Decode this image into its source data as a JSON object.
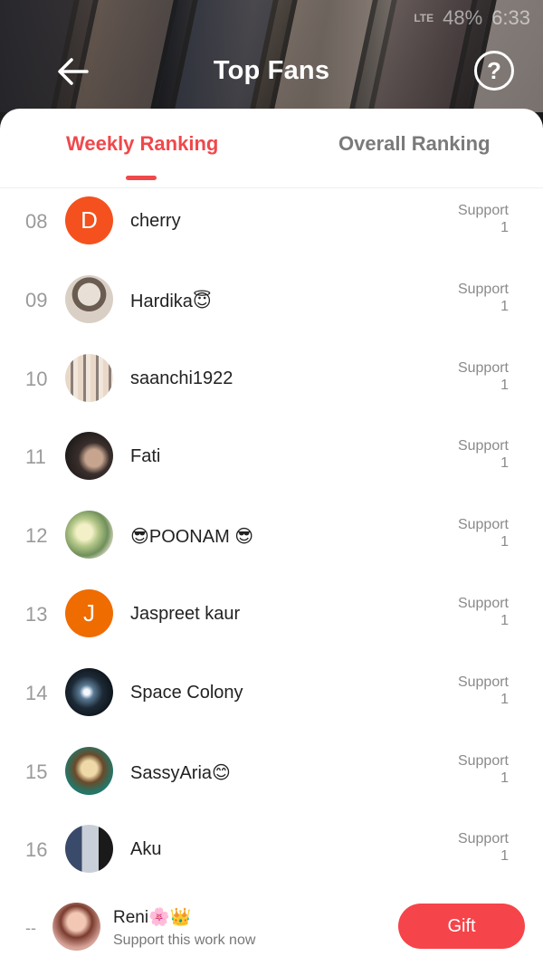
{
  "header": {
    "title": "Top Fans",
    "status_network": "LTE",
    "status_time": "6:33",
    "status_battery": "48%"
  },
  "tabs": [
    {
      "label": "Weekly Ranking",
      "active": true
    },
    {
      "label": "Overall Ranking",
      "active": false
    }
  ],
  "support_label": "Support",
  "fans": [
    {
      "rank": "08",
      "name": "cherry",
      "avatar_letter": "D",
      "avatar_type": "letter",
      "support": "1"
    },
    {
      "rank": "09",
      "name": "Hardika😇",
      "avatar_type": "photo",
      "support": "1"
    },
    {
      "rank": "10",
      "name": "saanchi1922",
      "avatar_type": "photo",
      "support": "1"
    },
    {
      "rank": "11",
      "name": "Fati",
      "avatar_type": "photo",
      "support": "1"
    },
    {
      "rank": "12",
      "name": "😎POONAM 😎",
      "avatar_type": "photo",
      "support": "1"
    },
    {
      "rank": "13",
      "name": "Jaspreet kaur",
      "avatar_letter": "J",
      "avatar_type": "letter",
      "support": "1"
    },
    {
      "rank": "14",
      "name": "Space Colony",
      "avatar_type": "photo",
      "support": "1"
    },
    {
      "rank": "15",
      "name": "SassyAria😊",
      "avatar_type": "photo",
      "support": "1"
    },
    {
      "rank": "16",
      "name": "Aku",
      "avatar_type": "photo",
      "support": "1"
    }
  ],
  "current_user": {
    "rank": "--",
    "name": "Reni🌸👑",
    "subtitle": "Support this work now",
    "gift_label": "Gift"
  },
  "colors": {
    "accent": "#f0484b",
    "gift_button": "#f5444a",
    "letter_avatar_1": "#f4511e",
    "letter_avatar_2": "#ef6c00"
  }
}
